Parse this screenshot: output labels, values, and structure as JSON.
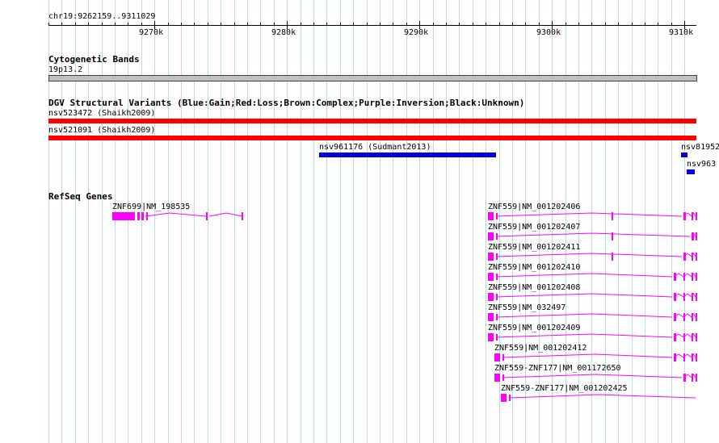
{
  "coord_label": "chr19:9262159..9311029",
  "ruler": {
    "ticks": [
      "9270k",
      "9280k",
      "9290k",
      "9300k",
      "9310k"
    ]
  },
  "cytobands": {
    "title": "Cytogenetic Bands",
    "band_label": "19p13.2"
  },
  "dgv": {
    "title": "DGV Structural Variants (Blue:Gain;Red:Loss;Brown:Complex;Purple:Inversion;Black:Unknown)",
    "variants": [
      {
        "label": "nsv523472 (Shaikh2009)",
        "color": "#ff0000",
        "type": "Loss"
      },
      {
        "label": "nsv521091 (Shaikh2009)",
        "color": "#ff0000",
        "type": "Loss"
      },
      {
        "label": "nsv961176 (Sudmant2013)",
        "color": "#0000dd",
        "type": "Gain"
      },
      {
        "label": "nsv81952",
        "color": "#0000dd",
        "type": "Gain"
      },
      {
        "label": "nsv963",
        "color": "#0000dd",
        "type": "Gain"
      }
    ]
  },
  "refseq": {
    "title": "RefSeq Genes",
    "genes": [
      {
        "label": "ZNF699|NM_198535"
      },
      {
        "label": "ZNF559|NM_001202406"
      },
      {
        "label": "ZNF559|NM_001202407"
      },
      {
        "label": "ZNF559|NM_001202411"
      },
      {
        "label": "ZNF559|NM_001202410"
      },
      {
        "label": "ZNF559|NM_001202408"
      },
      {
        "label": "ZNF559|NM_032497"
      },
      {
        "label": "ZNF559|NM_001202409"
      },
      {
        "label": "ZNF559|NM_001202412"
      },
      {
        "label": "ZNF559-ZNF177|NM_001172650"
      },
      {
        "label": "ZNF559-ZNF177|NM_001202425"
      }
    ]
  },
  "colors": {
    "grid": "#b8dcea",
    "gene": "#ff00ff",
    "loss": "#ff0000",
    "gain": "#0000dd",
    "cytoband": "#c0c0c0"
  }
}
